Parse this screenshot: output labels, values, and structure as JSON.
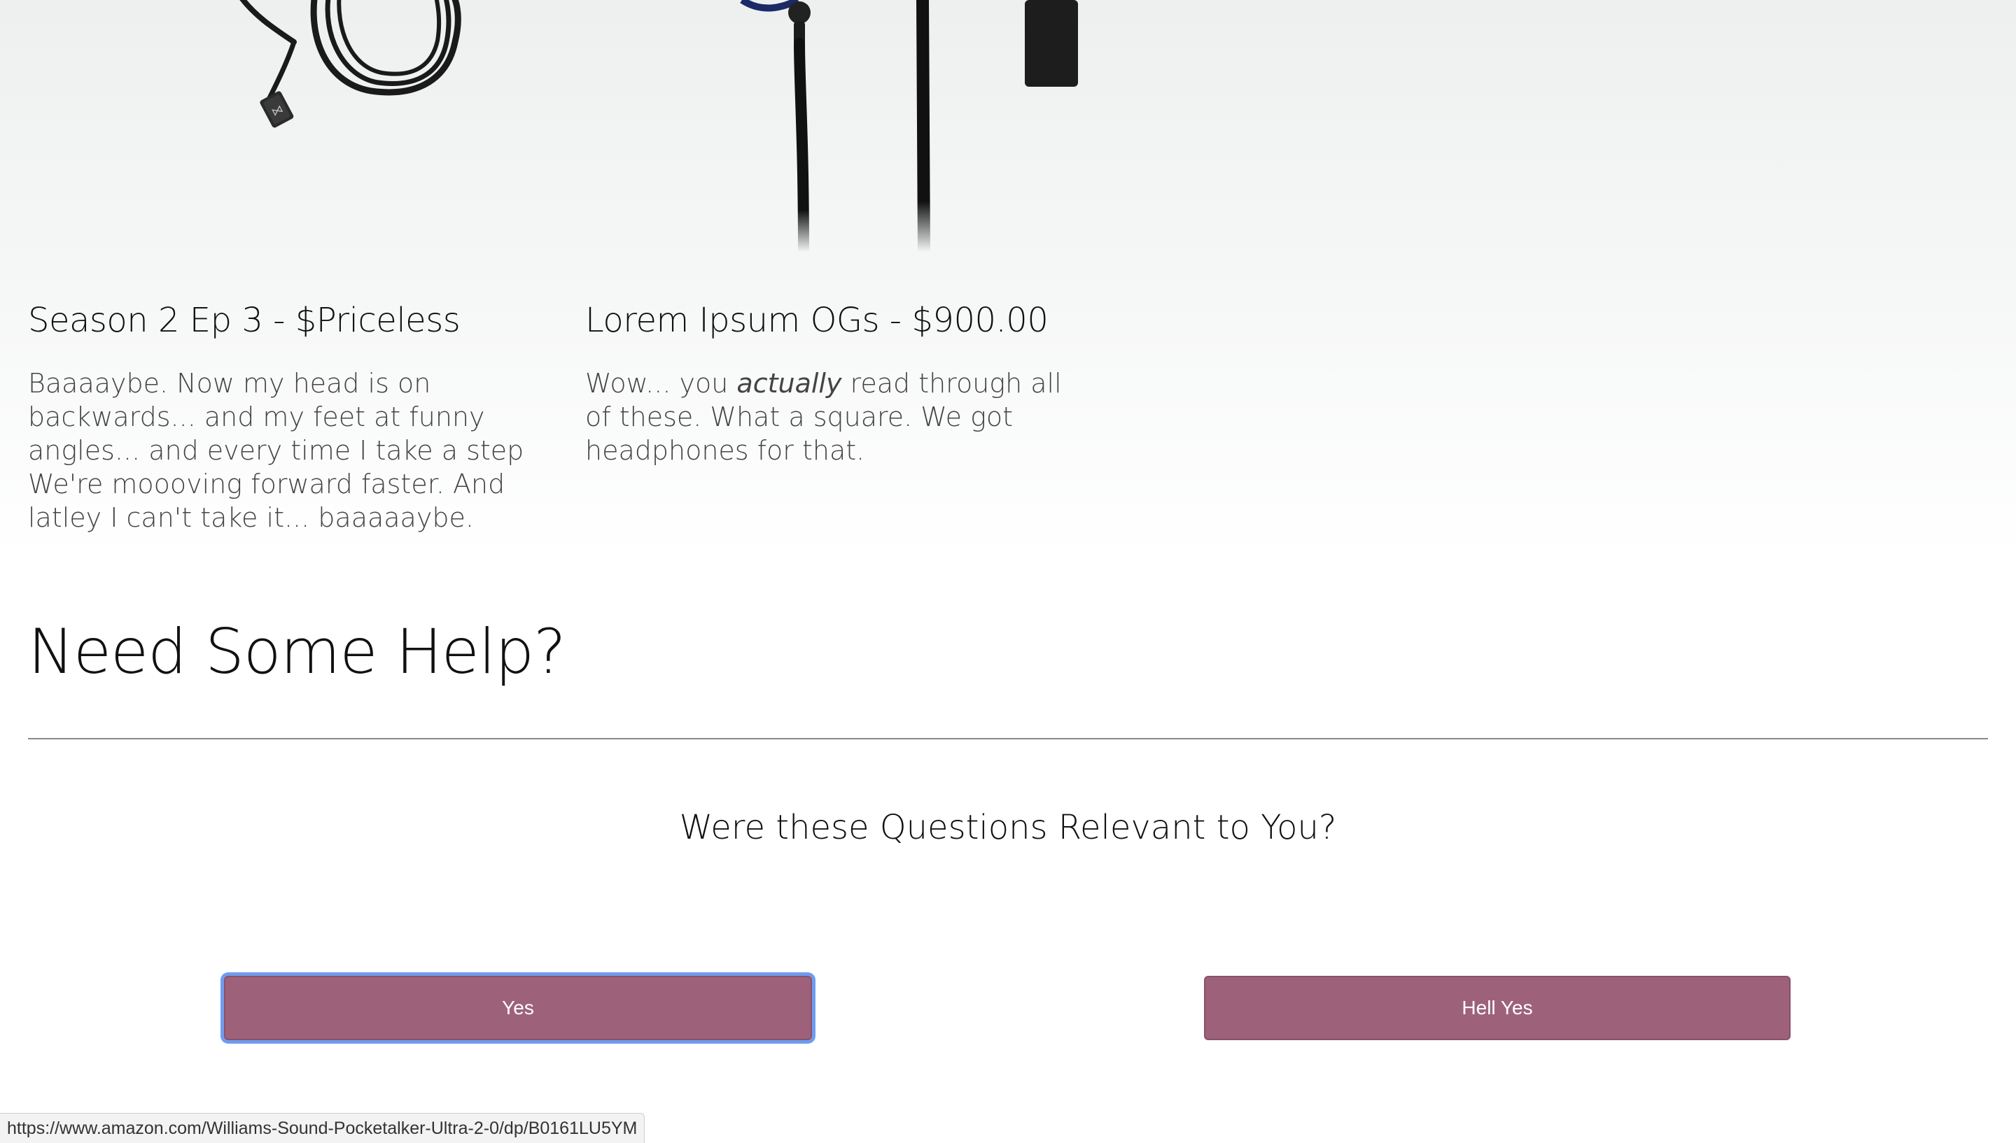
{
  "products": [
    {
      "title": "Season 2 Ep 3 - $Priceless",
      "description": "Baaaaybe. Now my head is on backwards... and my feet at funny angles... and every time I take a step We're moooving forward faster. And latley I can't take it... baaaaaybe.",
      "image_icon": "coiled-headphone-cable-icon"
    },
    {
      "title": "Lorem Ipsum OGs - $900.00",
      "description_before": "Wow... you ",
      "description_emphasis": "actually",
      "description_after": " read through all of these. What a square. We got headphones for that.",
      "image_icon": "headphone-cables-icon"
    }
  ],
  "help": {
    "title": "Need Some Help?",
    "question": "Were these Questions Relevant to You?",
    "yes_label": "Yes",
    "hell_yes_label": "Hell Yes",
    "button_color": "#9d6279",
    "focus_color": "#6f9cf0"
  },
  "status_bar": {
    "url": "https://www.amazon.com/Williams-Sound-Pocketalker-Ultra-2-0/dp/B0161LU5YM"
  }
}
